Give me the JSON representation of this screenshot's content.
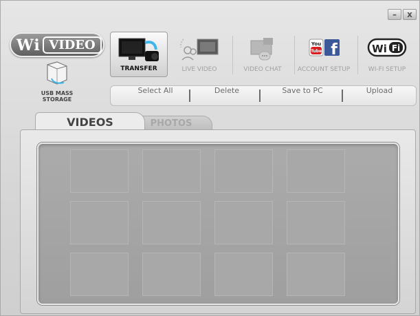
{
  "window": {
    "minimize": "–",
    "close": "x"
  },
  "logo": {
    "wi": "Wi",
    "video": "VIDEO"
  },
  "usb": {
    "label_line1": "USB MASS",
    "label_line2": "STORAGE"
  },
  "toolbar": {
    "items": [
      {
        "label": "TRANSFER",
        "icon": "transfer-icon",
        "active": true
      },
      {
        "label": "LIVE VIDEO",
        "icon": "live-video-icon"
      },
      {
        "label": "VIDEO CHAT",
        "icon": "video-chat-icon"
      },
      {
        "label": "ACCOUNT SETUP",
        "icon": "youtube-facebook-icon",
        "youtube_top": "You",
        "youtube_bottom": "Tube",
        "facebook": "f"
      },
      {
        "label": "WI-FI SETUP",
        "icon": "wifi-icon",
        "wi": "Wi",
        "fi": "Fi"
      }
    ]
  },
  "actions": {
    "select_all": "Select All",
    "delete": "Delete",
    "save": "Save to PC",
    "upload": "Upload"
  },
  "tabs": {
    "videos": "VIDEOS",
    "photos": "PHOTOS"
  },
  "grid": {
    "rows": 3,
    "cols": 4
  },
  "colors": {
    "youtube_red": "#d81e1e",
    "facebook_blue": "#3b5998",
    "accent_cyan": "#3fb6e8"
  }
}
